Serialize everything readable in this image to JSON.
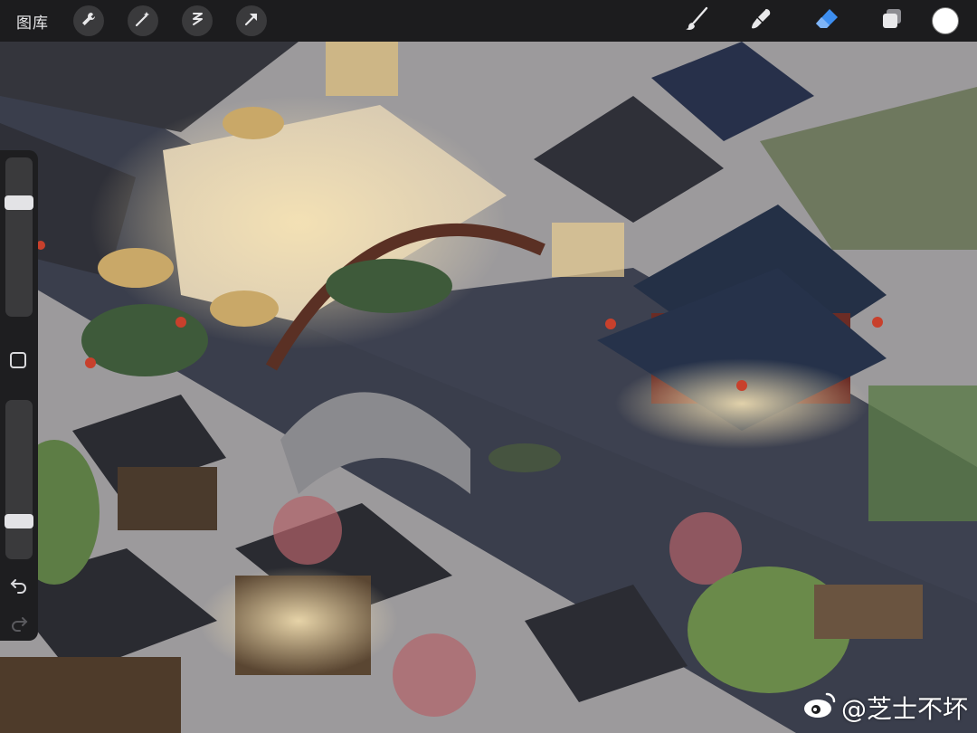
{
  "toolbar": {
    "gallery_label": "图库",
    "left_tools": [
      "wrench-icon",
      "magic-wand-icon",
      "selection-icon",
      "transform-arrow-icon"
    ],
    "right_tools": [
      "brush-icon",
      "smudge-icon",
      "eraser-icon",
      "layers-icon"
    ],
    "active_tool": "eraser-icon",
    "active_color": "#3d8ef0",
    "current_color": "#ffffff"
  },
  "sidebar": {
    "brush_size_level": 0.75,
    "opacity_level": 0.2
  },
  "watermark": {
    "text": "@芝士不坏"
  },
  "colors": {
    "toolbar_bg": "#1c1c1e",
    "canal_water": "#3a3e4c",
    "stone_street": "#b9b6b4",
    "roof_dark": "#2f3038",
    "lantern_red": "#c8402c",
    "lamp_glow": "#f3d9a0"
  }
}
